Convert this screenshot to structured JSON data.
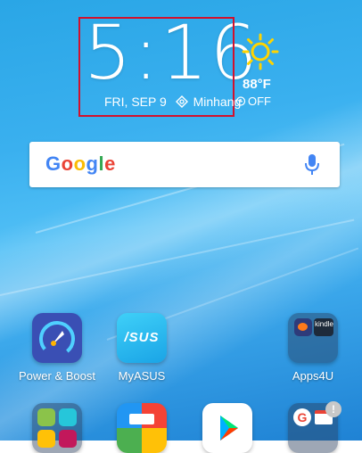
{
  "clock": {
    "time": "5:16",
    "date": "FRI, SEP 9",
    "location": "Minhang"
  },
  "weather": {
    "temperature": "88°F",
    "alarm": "OFF",
    "icon": "sun-icon"
  },
  "search": {
    "logo": "Google",
    "icon": "mic-icon"
  },
  "apps": [
    {
      "label": "Power & Boost",
      "icon": "rocket-speedometer-icon"
    },
    {
      "label": "MyASUS",
      "icon": "asus-logo-icon",
      "logo_text": "/SUS"
    },
    {
      "label": "Apps4U",
      "icon": "folder-icon",
      "kindle_text": "kindle"
    }
  ],
  "dock": [
    {
      "icon": "folder-icon"
    },
    {
      "icon": "paint-roller-icon"
    },
    {
      "icon": "play-store-icon"
    },
    {
      "icon": "google-folder-icon",
      "badge": "!"
    }
  ],
  "colors": {
    "highlight_border": "#d2112d",
    "sun": "#ffd400",
    "accent_blue": "#4285f4"
  }
}
